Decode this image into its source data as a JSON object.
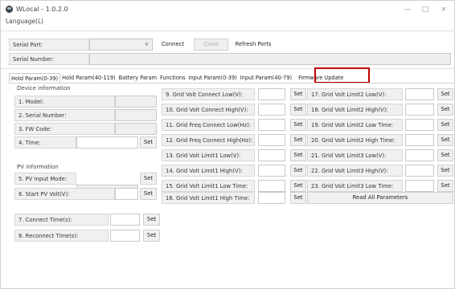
{
  "app": {
    "title": "WLocal - 1.0.2.0",
    "menu": "Language(L)"
  },
  "window_controls": {
    "minimize": "—",
    "maximize": "□",
    "close": "×"
  },
  "serial": {
    "port_label": "Serial Port:",
    "number_label": "Serial Number:",
    "connect": "Connect",
    "close": "Close",
    "refresh": "Refresh Ports",
    "chevron": "∨"
  },
  "tabs": [
    "Hold Param(0-39)",
    "Hold Param(40-119)",
    "Battery Param",
    "Functions",
    "Input Param(0-39)",
    "Input Param(40-79)",
    "Firmware Update"
  ],
  "device": {
    "group": "Device information",
    "model": "1. Model:",
    "serial": "2. Serial Number:",
    "fw": "3. FW Code:",
    "time": "4. Time:",
    "set": "Set"
  },
  "pv": {
    "group": "PV information",
    "mode": "5. PV Input Mode:",
    "start": "6. Start PV Volt(V):",
    "set": "Set",
    "chevron": "∨"
  },
  "connect_time": {
    "label": "7. Connect Time(s):",
    "set": "Set"
  },
  "reconnect_time": {
    "label": "8. Reconnect Time(s):",
    "set": "Set"
  },
  "col2": [
    "9. Grid Volt Connect Low(V):",
    "10. Grid Volt Connect High(V):",
    "11. Grid Freq Connect Low(Hz):",
    "12. Grid Freq Connect High(Hz):",
    "13. Grid Volt Limit1 Low(V):",
    "14. Grid Volt Limit1 High(V):",
    "15. Grid Volt Limit1 Low Time:",
    "16. Grid Volt Limit1 High Time:"
  ],
  "col3": [
    "17. Grid Volt Limit2 Low(V):",
    "18. Grid Volt Limit2 High(V):",
    "19. Grid Volt Limit2 Low Time:",
    "20. Grid Volt Limit2 High Time:",
    "21. Grid Volt Limit3 Low(V):",
    "22. Grid Volt Limit3 High(V):",
    "23. Grid Volt Limit3 Low Time:"
  ],
  "set_label": "Set",
  "read_all": "Read All Parameters"
}
